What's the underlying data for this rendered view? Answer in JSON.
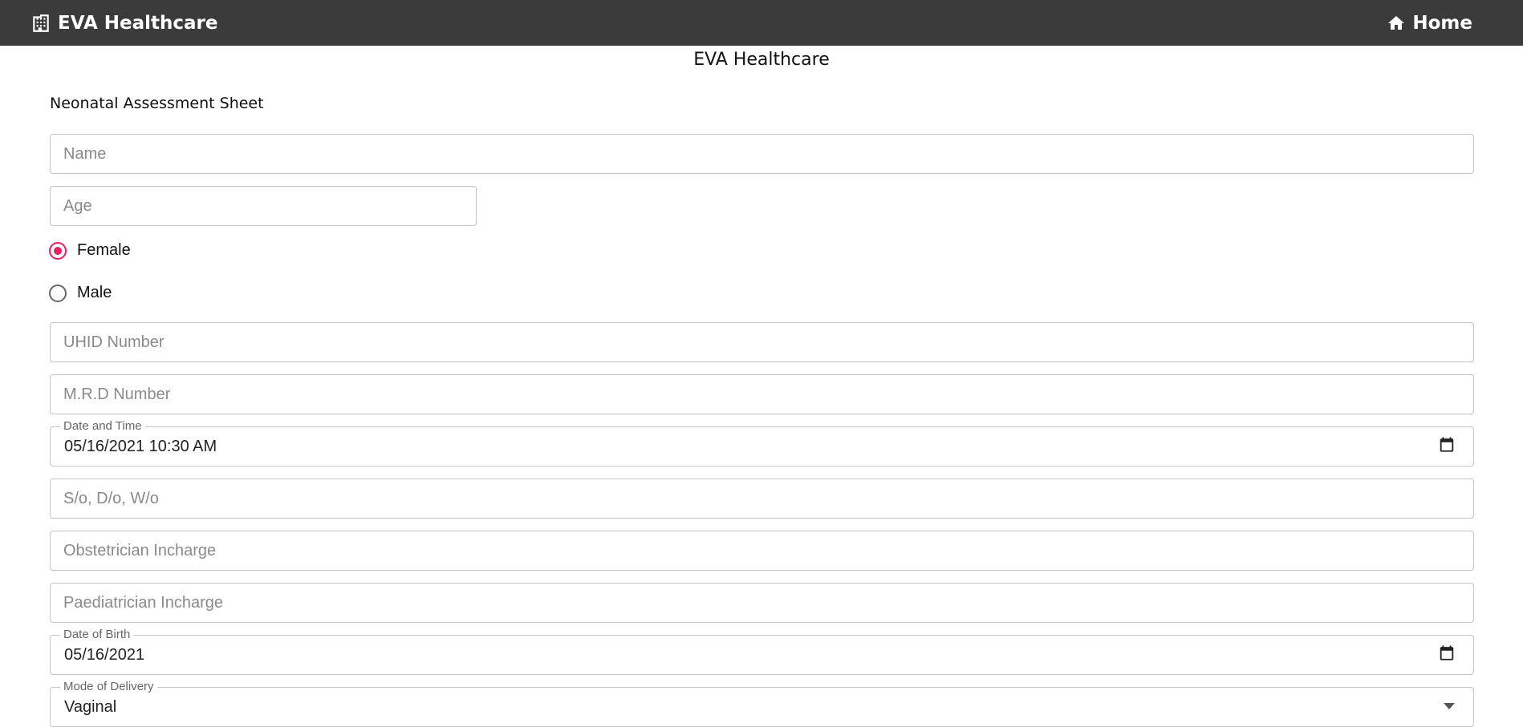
{
  "app": {
    "brand_title": "EVA Healthcare",
    "home_label": "Home",
    "bar_color": "#3b3b3b"
  },
  "page": {
    "title": "EVA Healthcare",
    "form_title": "Neonatal Assessment Sheet"
  },
  "fields": {
    "name": {
      "placeholder": "Name",
      "value": ""
    },
    "age": {
      "placeholder": "Age",
      "value": ""
    },
    "uhid": {
      "placeholder": "UHID Number",
      "value": ""
    },
    "mrd": {
      "placeholder": "M.R.D Number",
      "value": ""
    },
    "date_time": {
      "label": "Date and Time",
      "value": "05/16/2021 10:30 AM",
      "icon": "calendar-icon"
    },
    "relation": {
      "placeholder": "S/o, D/o, W/o",
      "value": ""
    },
    "obstetrician": {
      "placeholder": "Obstetrician Incharge",
      "value": ""
    },
    "paediatrician": {
      "placeholder": "Paediatrician Incharge",
      "value": ""
    },
    "dob": {
      "label": "Date of Birth",
      "value": "05/16/2021",
      "icon": "calendar-icon"
    },
    "delivery_mode": {
      "label": "Mode of Delivery",
      "value": "Vaginal",
      "icon": "dropdown-arrow-icon"
    }
  },
  "gender": {
    "options": [
      {
        "label": "Female",
        "selected": true
      },
      {
        "label": "Male",
        "selected": false
      }
    ],
    "accent_color": "#e91e63"
  }
}
